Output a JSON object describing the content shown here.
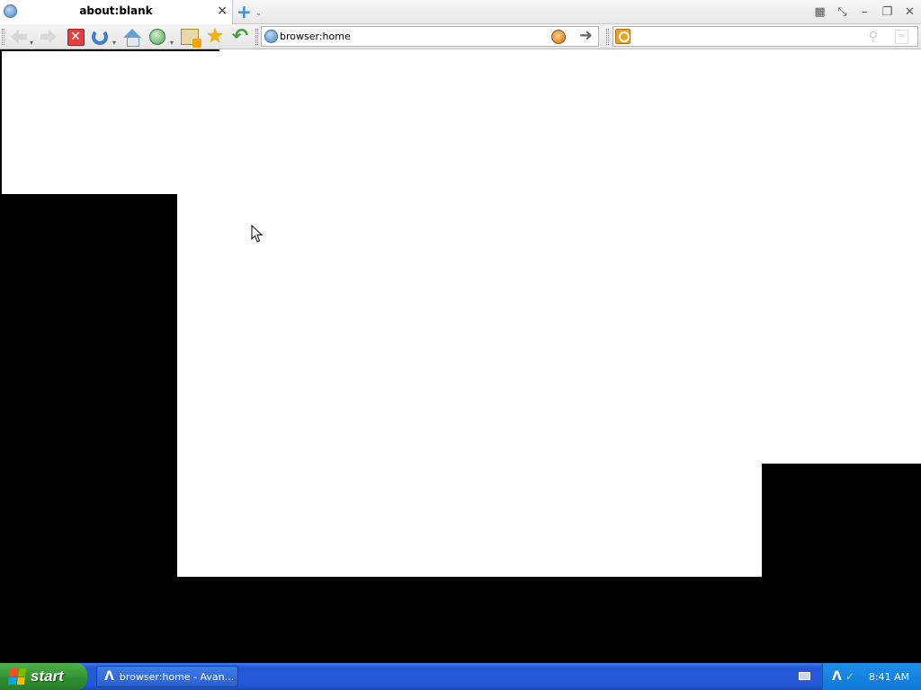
{
  "browser": {
    "tab": {
      "title": "about:blank",
      "close": "×"
    },
    "new_tab": "+",
    "new_tab_dropdown": "⌄",
    "window_controls": {
      "grid": "▦",
      "pin": "⤡",
      "minimize": "–",
      "restore": "❐",
      "close": "✕"
    },
    "toolbar": {
      "stop": "✕",
      "star": "★",
      "undo": "↶"
    },
    "address": {
      "url": "browser:home",
      "go": "➜"
    },
    "search": {
      "placeholder": "",
      "magnifier": "⚲",
      "button": "≈"
    }
  },
  "taskbar": {
    "start_label": "start",
    "task_button_label": "browser:home - Avan...",
    "task_icon": "Λ",
    "tray_icon_1": "Λ",
    "tray_icon_2": "✓",
    "clock": "8:41 AM"
  },
  "colors": {
    "start_green": "#2f8f2f",
    "taskbar_blue": "#245ad8",
    "tray_blue": "#1278d8",
    "stop_red": "#e04040",
    "new_tab_blue": "#3b8fd6"
  }
}
